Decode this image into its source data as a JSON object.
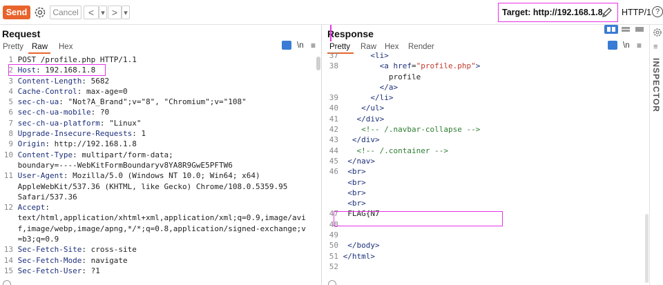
{
  "toolbar": {
    "send_label": "Send",
    "cancel_label": "Cancel",
    "back_label": "<",
    "back_dd": "▾",
    "fwd_label": ">",
    "fwd_dd": "▾",
    "target_label": "Target: http://192.168.1.8",
    "protocol_label": "HTTP/1",
    "help_label": "?"
  },
  "request": {
    "title": "Request",
    "tabs": [
      "Pretty",
      "Raw",
      "Hex"
    ],
    "active_tab": "Raw",
    "ln_label": "\\n",
    "lines": [
      {
        "n": "1",
        "k": "",
        "v": "POST /profile.php HTTP/1.1"
      },
      {
        "n": "2",
        "k": "Host",
        "v": ": 192.168.1.8"
      },
      {
        "n": "3",
        "k": "Content-Length",
        "v": ": 5682"
      },
      {
        "n": "4",
        "k": "Cache-Control",
        "v": ": max-age=0"
      },
      {
        "n": "5",
        "k": "sec-ch-ua",
        "v": ": \"Not?A_Brand\";v=\"8\", \"Chromium\";v=\"108\""
      },
      {
        "n": "6",
        "k": "sec-ch-ua-mobile",
        "v": ": ?0"
      },
      {
        "n": "7",
        "k": "sec-ch-ua-platform",
        "v": ": \"Linux\""
      },
      {
        "n": "8",
        "k": "Upgrade-Insecure-Requests",
        "v": ": 1"
      },
      {
        "n": "9",
        "k": "Origin",
        "v": ": http://192.168.1.8"
      },
      {
        "n": "10",
        "k": "Content-Type",
        "v": ": multipart/form-data;"
      },
      {
        "n": "",
        "k": "",
        "v": "boundary=----WebKitFormBoundaryv8YA8R9GwE5PFTW6"
      },
      {
        "n": "11",
        "k": "User-Agent",
        "v": ": Mozilla/5.0 (Windows NT 10.0; Win64; x64)"
      },
      {
        "n": "",
        "k": "",
        "v": "AppleWebKit/537.36 (KHTML, like Gecko) Chrome/108.0.5359.95"
      },
      {
        "n": "",
        "k": "",
        "v": "Safari/537.36"
      },
      {
        "n": "12",
        "k": "Accept",
        "v": ":"
      },
      {
        "n": "",
        "k": "",
        "v": "text/html,application/xhtml+xml,application/xml;q=0.9,image/avi"
      },
      {
        "n": "",
        "k": "",
        "v": "f,image/webp,image/apng,*/*;q=0.8,application/signed-exchange;v"
      },
      {
        "n": "",
        "k": "",
        "v": "=b3;q=0.9"
      },
      {
        "n": "13",
        "k": "Sec-Fetch-Site",
        "v": ": cross-site"
      },
      {
        "n": "14",
        "k": "Sec-Fetch-Mode",
        "v": ": navigate"
      },
      {
        "n": "15",
        "k": "Sec-Fetch-User",
        "v": ": ?1"
      }
    ]
  },
  "response": {
    "title": "Response",
    "tabs": [
      "Pretty",
      "Raw",
      "Hex",
      "Render"
    ],
    "active_tab": "Pretty",
    "ln_label": "\\n",
    "lines": [
      {
        "n": "37",
        "html": "      <span class=\"tag\">&lt;li&gt;</span>"
      },
      {
        "n": "38",
        "html": "        <span class=\"tag\">&lt;a</span> <span class=\"attr\">href</span>=<span class=\"aval\">\"profile.php\"</span><span class=\"tag\">&gt;</span>"
      },
      {
        "n": "",
        "html": "          profile"
      },
      {
        "n": "",
        "html": "        <span class=\"tag\">&lt;/a&gt;</span>"
      },
      {
        "n": "39",
        "html": "      <span class=\"tag\">&lt;/li&gt;</span>"
      },
      {
        "n": "40",
        "html": "    <span class=\"tag\">&lt;/ul&gt;</span>"
      },
      {
        "n": "41",
        "html": "   <span class=\"tag\">&lt;/div&gt;</span>"
      },
      {
        "n": "42",
        "html": "    <span class=\"cmt\">&lt;!-- /.navbar-collapse --&gt;</span>"
      },
      {
        "n": "43",
        "html": "  <span class=\"tag\">&lt;/div&gt;</span>"
      },
      {
        "n": "44",
        "html": "   <span class=\"cmt\">&lt;!-- /.container --&gt;</span>"
      },
      {
        "n": "45",
        "html": " <span class=\"tag\">&lt;/nav&gt;</span>"
      },
      {
        "n": "46",
        "html": " <span class=\"tag\">&lt;br&gt;</span>"
      },
      {
        "n": "",
        "html": " <span class=\"tag\">&lt;br&gt;</span>"
      },
      {
        "n": "",
        "html": " <span class=\"tag\">&lt;br&gt;</span>"
      },
      {
        "n": "",
        "html": " <span class=\"tag\">&lt;br&gt;</span>"
      },
      {
        "n": "47",
        "html": " FLAG{N7"
      },
      {
        "n": "48",
        "html": ""
      },
      {
        "n": "49",
        "html": ""
      },
      {
        "n": "50",
        "html": " <span class=\"tag\">&lt;/body&gt;</span>"
      },
      {
        "n": "51",
        "html": "<span class=\"tag\">&lt;/html&gt;</span>"
      },
      {
        "n": "52",
        "html": ""
      }
    ]
  },
  "inspector_label": "INSPECTOR",
  "colors": {
    "accent": "#e8642c",
    "highlight": "#e632e6",
    "header_key": "#1c2f7a"
  }
}
